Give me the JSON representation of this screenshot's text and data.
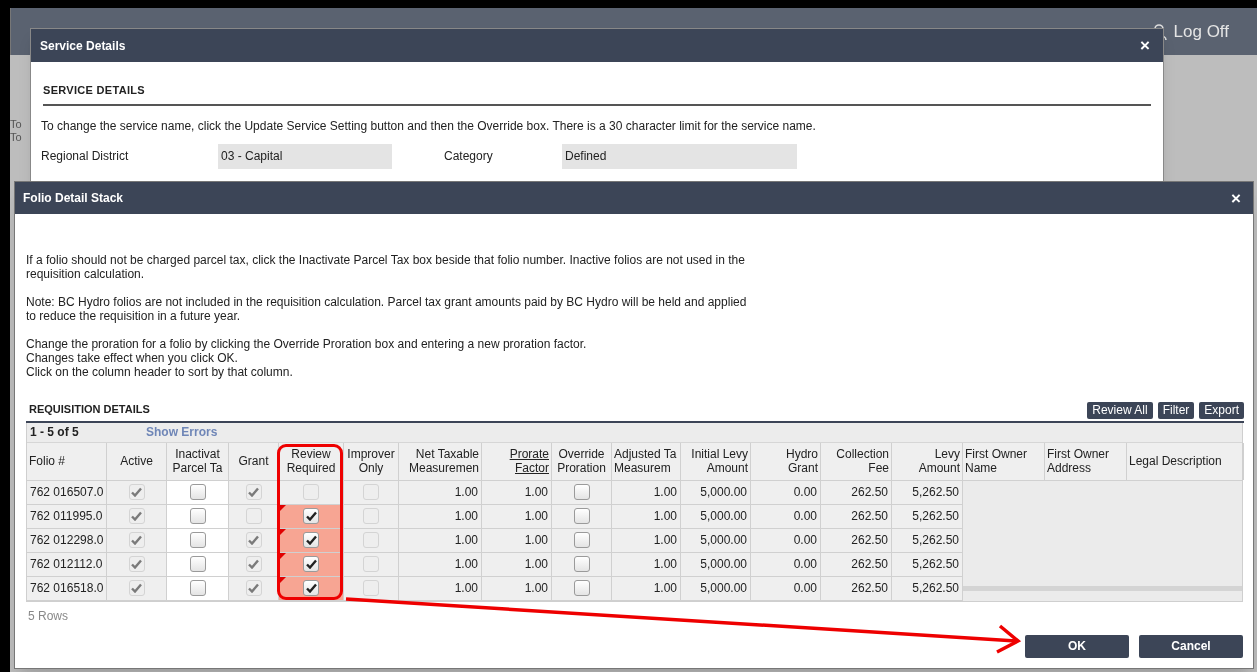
{
  "app": {
    "log_off": "Log Off",
    "side_texts": [
      "To",
      "To"
    ]
  },
  "service_dialog": {
    "title": "Service Details",
    "close": "×",
    "section": "SERVICE DETAILS",
    "instructions": "To change the service name, click the Update Service Setting button and then the Override box. There is a 30 character limit for the service name.",
    "fields": [
      {
        "label": "Regional District",
        "value": "03 - Capital"
      },
      {
        "label": "Category",
        "value": "Defined"
      }
    ]
  },
  "folio_dialog": {
    "title": "Folio Detail Stack",
    "close": "×",
    "paragraphs": [
      [
        "If a folio should not be charged parcel tax, click the Inactivate Parcel Tax box beside that folio number. Inactive folios are not used in the",
        "requisition calculation."
      ],
      [
        "Note: BC Hydro folios are not included in the requisition calculation. Parcel tax grant amounts paid by BC Hydro will be held and applied",
        "to reduce the requisition in a future year."
      ],
      [
        "Change the proration for a folio by clicking the Override Proration box and entering a new proration factor.",
        "Changes take effect when you click OK.",
        "Click on the column header to sort by that column."
      ]
    ],
    "section": "REQUISITION DETAILS",
    "toolbar_buttons": [
      "Review All",
      "Filter",
      "Export"
    ],
    "range": "1 - 5 of 5",
    "show_errors": "Show Errors",
    "columns": [
      {
        "label": [
          "Folio #"
        ],
        "underlined": false
      },
      {
        "label": [
          "Active"
        ],
        "underlined": false
      },
      {
        "label": [
          "Inactivat",
          "Parcel Ta"
        ],
        "underlined": false
      },
      {
        "label": [
          "Grant"
        ],
        "underlined": false
      },
      {
        "label": [
          "Review",
          "Required"
        ],
        "underlined": false
      },
      {
        "label": [
          "Improver",
          "Only"
        ],
        "underlined": false
      },
      {
        "label": [
          "Net Taxable",
          "Measuremen"
        ],
        "underlined": false
      },
      {
        "label": [
          "Prorate",
          "Factor"
        ],
        "underlined": true
      },
      {
        "label": [
          "Override",
          "Proration"
        ],
        "underlined": false
      },
      {
        "label": [
          "Adjusted Ta",
          "Measurem"
        ],
        "underlined": false
      },
      {
        "label": [
          "Initial Levy",
          "Amount"
        ],
        "underlined": false
      },
      {
        "label": [
          "Hydro",
          "Grant"
        ],
        "underlined": false
      },
      {
        "label": [
          "Collection",
          "Fee"
        ],
        "underlined": false
      },
      {
        "label": [
          "Levy",
          "Amount"
        ],
        "underlined": false
      },
      {
        "label": [
          "First Owner",
          "Name"
        ],
        "underlined": false
      },
      {
        "label": [
          "First Owner",
          "Address"
        ],
        "underlined": false
      },
      {
        "label": [
          "Legal Description"
        ],
        "underlined": false
      }
    ],
    "rows": [
      {
        "folio": "762 016507.0",
        "active": {
          "checked": true,
          "disabled": true
        },
        "inactivate": {
          "checked": false,
          "disabled": false
        },
        "grant": {
          "checked": true,
          "disabled": true
        },
        "review": {
          "checked": false,
          "disabled": true,
          "error": false
        },
        "improver": {
          "checked": false,
          "disabled": true
        },
        "net": "1.00",
        "prorate": "1.00",
        "override": {
          "checked": false,
          "disabled": false
        },
        "adjusted": "1.00",
        "initial": "5,000.00",
        "hydro": "0.00",
        "fee": "262.50",
        "levy": "5,262.50"
      },
      {
        "folio": "762 011995.0",
        "active": {
          "checked": true,
          "disabled": true
        },
        "inactivate": {
          "checked": false,
          "disabled": false
        },
        "grant": {
          "checked": false,
          "disabled": true
        },
        "review": {
          "checked": true,
          "disabled": false,
          "error": true
        },
        "improver": {
          "checked": false,
          "disabled": true
        },
        "net": "1.00",
        "prorate": "1.00",
        "override": {
          "checked": false,
          "disabled": false
        },
        "adjusted": "1.00",
        "initial": "5,000.00",
        "hydro": "0.00",
        "fee": "262.50",
        "levy": "5,262.50"
      },
      {
        "folio": "762 012298.0",
        "active": {
          "checked": true,
          "disabled": true
        },
        "inactivate": {
          "checked": false,
          "disabled": false
        },
        "grant": {
          "checked": true,
          "disabled": true
        },
        "review": {
          "checked": true,
          "disabled": false,
          "error": true
        },
        "improver": {
          "checked": false,
          "disabled": true
        },
        "net": "1.00",
        "prorate": "1.00",
        "override": {
          "checked": false,
          "disabled": false
        },
        "adjusted": "1.00",
        "initial": "5,000.00",
        "hydro": "0.00",
        "fee": "262.50",
        "levy": "5,262.50"
      },
      {
        "folio": "762 012112.0",
        "active": {
          "checked": true,
          "disabled": true
        },
        "inactivate": {
          "checked": false,
          "disabled": false
        },
        "grant": {
          "checked": true,
          "disabled": true
        },
        "review": {
          "checked": true,
          "disabled": false,
          "error": true
        },
        "improver": {
          "checked": false,
          "disabled": true
        },
        "net": "1.00",
        "prorate": "1.00",
        "override": {
          "checked": false,
          "disabled": false
        },
        "adjusted": "1.00",
        "initial": "5,000.00",
        "hydro": "0.00",
        "fee": "262.50",
        "levy": "5,262.50"
      },
      {
        "folio": "762 016518.0",
        "active": {
          "checked": true,
          "disabled": true
        },
        "inactivate": {
          "checked": false,
          "disabled": false
        },
        "grant": {
          "checked": true,
          "disabled": true
        },
        "review": {
          "checked": true,
          "disabled": false,
          "error": true
        },
        "improver": {
          "checked": false,
          "disabled": true
        },
        "net": "1.00",
        "prorate": "1.00",
        "override": {
          "checked": false,
          "disabled": false
        },
        "adjusted": "1.00",
        "initial": "5,000.00",
        "hydro": "0.00",
        "fee": "262.50",
        "levy": "5,262.50"
      }
    ],
    "row_count": "5 Rows",
    "buttons": [
      "OK",
      "Cancel"
    ]
  }
}
